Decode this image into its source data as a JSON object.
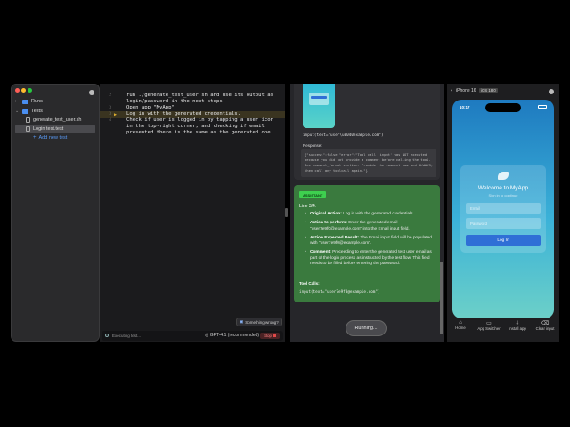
{
  "sidebar": {
    "runs_label": "Runs",
    "tests_label": "Tests",
    "items": [
      "generate_test_user.sh",
      "Login test.test"
    ],
    "add_label": "Add new test"
  },
  "editor": {
    "lines": [
      {
        "num": "2",
        "text": "run ./generate_test_user.sh and use its output as"
      },
      {
        "num": "",
        "text": "login/password in the next steps"
      },
      {
        "num": "3",
        "text": "Open app \"MyApp\""
      },
      {
        "num": "3",
        "text": "Log in with the generated credentials."
      },
      {
        "num": "4",
        "text": "Check if user is logged in by tapping a user icon"
      },
      {
        "num": "",
        "text": "in the top-right corner, and checking if email"
      },
      {
        "num": "",
        "text": "presented there is the same as the generated one"
      }
    ],
    "feedback_label": "Something wrong?",
    "status_text": "Executing test...",
    "model_label": "GPT-4.1 (recommended)",
    "stop_label": "Stop"
  },
  "middle": {
    "tool_call_1": "input(text=\"user\\u0040example.com\")",
    "response_label": "Response:",
    "response_text": "{\"success\":false,\"error\":\"Tool call 'input' was NOT executed because you did not provide a comment before calling the tool. See comment_format section. Provide the comment now and ALWAYS, then call any toolcall again.\"}",
    "badge": "ASSISTANT",
    "line_label": "Line 3/4:",
    "items": [
      {
        "label": "Original Action:",
        "text": "Log in with the generated credentials."
      },
      {
        "label": "Action to perform:",
        "text": "Enter the generated email \"user7e9f0@example.com\" into the Email input field."
      },
      {
        "label": "Action Expected Result:",
        "text": "The Email input field will be populated with \"user7e9f0@example.com\"."
      },
      {
        "label": "Comment:",
        "text": "Proceeding to enter the generated test user email as part of the login process as instructed by the test flow. This field needs to be filled before entering the password."
      }
    ],
    "tool_calls_label": "Tool Calls:",
    "tool_call_2": "input(text=\"user7e9f0@example.com\")",
    "running_label": "Running..."
  },
  "phone": {
    "device_name": "iPhone 16",
    "os_version": "iOS 18.0",
    "time": "10:17",
    "welcome": "Welcome to MyApp",
    "subtitle": "Sign in to continue",
    "email_placeholder": "Email",
    "password_placeholder": "Password",
    "login_label": "Log In",
    "bottom": [
      "Home",
      "App Switcher",
      "Install app",
      "Clear input"
    ]
  },
  "colors": {
    "accent": "#2f6fd6",
    "assistant_green": "#3a7a3e",
    "badge_green": "#3ecf4f",
    "stop_red": "#e04848"
  }
}
